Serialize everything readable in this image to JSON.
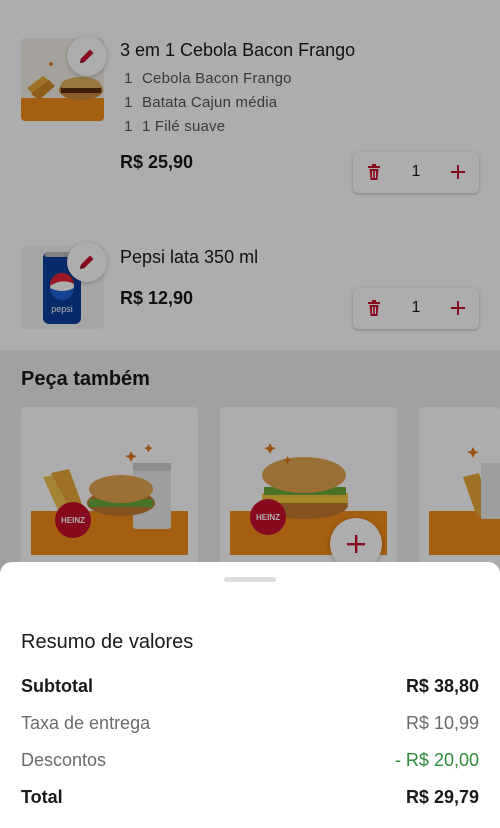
{
  "colors": {
    "accent_red": "#c8102e",
    "discount_green": "#2e8b3a",
    "overlay": "rgba(0,0,0,0.32)"
  },
  "cart": {
    "items": [
      {
        "name": "3 em 1 Cebola Bacon Frango",
        "options": [
          {
            "qty": "1",
            "label": "Cebola Bacon Frango"
          },
          {
            "qty": "1",
            "label": "Batata Cajun média"
          },
          {
            "qty": "1",
            "label": "1 Filé suave"
          }
        ],
        "price": "R$ 25,90",
        "quantity": "1",
        "icons": {
          "edit": "pencil-icon",
          "remove": "trash-icon",
          "add": "plus-icon"
        }
      },
      {
        "name": "Pepsi lata 350 ml",
        "options": [],
        "price": "R$ 12,90",
        "quantity": "1",
        "icons": {
          "edit": "pencil-icon",
          "remove": "trash-icon",
          "add": "plus-icon"
        },
        "image_text": "pepsi"
      }
    ]
  },
  "upsell": {
    "title": "Peça também",
    "card_brand": "HEINZ",
    "add_icon": "plus-icon"
  },
  "summary": {
    "title": "Resumo de valores",
    "subtotal_label": "Subtotal",
    "subtotal_value": "R$ 38,80",
    "delivery_label": "Taxa de entrega",
    "delivery_value": "R$ 10,99",
    "discount_label": "Descontos",
    "discount_value": "- R$ 20,00",
    "total_label": "Total",
    "total_value": "R$ 29,79"
  }
}
